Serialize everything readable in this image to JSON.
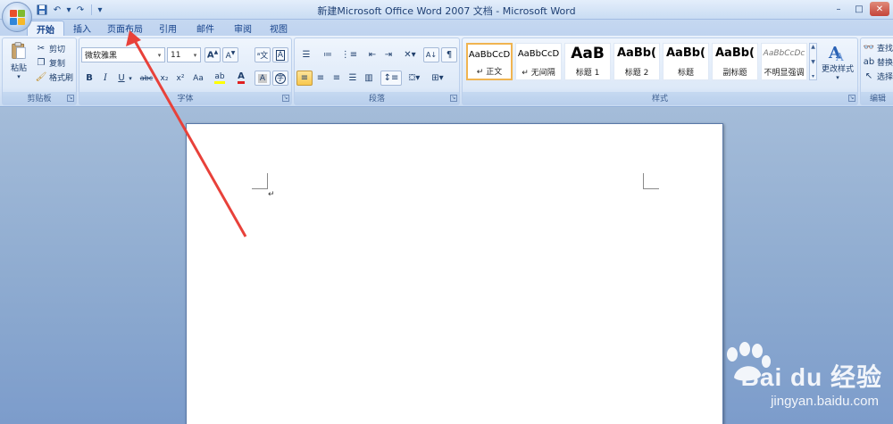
{
  "window": {
    "title": "新建Microsoft Office Word 2007 文档 - Microsoft Word",
    "controls": {
      "minimize": "–",
      "maximize": "□",
      "close": "✕"
    }
  },
  "quick_access": {
    "icons": [
      "word-icon",
      "save-icon",
      "undo-icon",
      "redo-icon"
    ],
    "undo": "↶",
    "redo": "↷",
    "more": "▾"
  },
  "tabs": [
    {
      "label": "开始",
      "active": true
    },
    {
      "label": "插入",
      "active": false
    },
    {
      "label": "页面布局",
      "active": false
    },
    {
      "label": "引用",
      "active": false
    },
    {
      "label": "邮件",
      "active": false
    },
    {
      "label": "审阅",
      "active": false
    },
    {
      "label": "视图",
      "active": false
    }
  ],
  "ribbon": {
    "clipboard": {
      "label": "剪贴板",
      "paste": "粘贴",
      "cut": "剪切",
      "copy": "复制",
      "format_painter": "格式刷"
    },
    "font": {
      "label": "字体",
      "font_name": "微软雅黑",
      "font_size": "11",
      "buttons": [
        "B",
        "I",
        "U",
        "abc",
        "x₂",
        "x²",
        "Aa",
        "A"
      ]
    },
    "paragraph": {
      "label": "段落"
    },
    "styles": {
      "label": "样式",
      "items": [
        {
          "sample": "AaBbCcD",
          "name": "↵ 正文",
          "selected": true
        },
        {
          "sample": "AaBbCcD",
          "name": "↵ 无间隔",
          "selected": false
        },
        {
          "sample": "AaB",
          "name": "标题 1",
          "selected": false
        },
        {
          "sample": "AaBb(",
          "name": "标题 2",
          "selected": false
        },
        {
          "sample": "AaBb(",
          "name": "标题",
          "selected": false
        },
        {
          "sample": "AaBb(",
          "name": "副标题",
          "selected": false
        },
        {
          "sample": "AaBbCcDc",
          "name": "不明显强调",
          "selected": false
        }
      ],
      "change_styles": "更改样式"
    },
    "editing": {
      "label": "编辑",
      "find": "查找",
      "replace": "替换",
      "select": "选择"
    }
  },
  "document": {
    "paragraph_mark": "↵"
  },
  "watermark": {
    "brand": "Bai du 经验",
    "url": "jingyan.baidu.com"
  },
  "colors": {
    "accent": "#e8413a",
    "ribbon": "#dbe7f7",
    "document_bg": "#8eabd0"
  }
}
